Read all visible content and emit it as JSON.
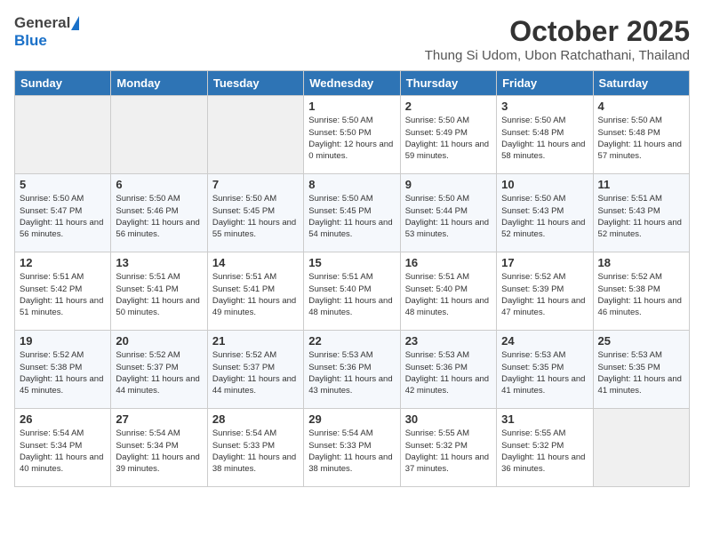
{
  "header": {
    "logo_general": "General",
    "logo_blue": "Blue",
    "month_year": "October 2025",
    "location": "Thung Si Udom, Ubon Ratchathani, Thailand"
  },
  "days_of_week": [
    "Sunday",
    "Monday",
    "Tuesday",
    "Wednesday",
    "Thursday",
    "Friday",
    "Saturday"
  ],
  "weeks": [
    [
      {
        "day": "",
        "info": ""
      },
      {
        "day": "",
        "info": ""
      },
      {
        "day": "",
        "info": ""
      },
      {
        "day": "1",
        "info": "Sunrise: 5:50 AM\nSunset: 5:50 PM\nDaylight: 12 hours\nand 0 minutes."
      },
      {
        "day": "2",
        "info": "Sunrise: 5:50 AM\nSunset: 5:49 PM\nDaylight: 11 hours\nand 59 minutes."
      },
      {
        "day": "3",
        "info": "Sunrise: 5:50 AM\nSunset: 5:48 PM\nDaylight: 11 hours\nand 58 minutes."
      },
      {
        "day": "4",
        "info": "Sunrise: 5:50 AM\nSunset: 5:48 PM\nDaylight: 11 hours\nand 57 minutes."
      }
    ],
    [
      {
        "day": "5",
        "info": "Sunrise: 5:50 AM\nSunset: 5:47 PM\nDaylight: 11 hours\nand 56 minutes."
      },
      {
        "day": "6",
        "info": "Sunrise: 5:50 AM\nSunset: 5:46 PM\nDaylight: 11 hours\nand 56 minutes."
      },
      {
        "day": "7",
        "info": "Sunrise: 5:50 AM\nSunset: 5:45 PM\nDaylight: 11 hours\nand 55 minutes."
      },
      {
        "day": "8",
        "info": "Sunrise: 5:50 AM\nSunset: 5:45 PM\nDaylight: 11 hours\nand 54 minutes."
      },
      {
        "day": "9",
        "info": "Sunrise: 5:50 AM\nSunset: 5:44 PM\nDaylight: 11 hours\nand 53 minutes."
      },
      {
        "day": "10",
        "info": "Sunrise: 5:50 AM\nSunset: 5:43 PM\nDaylight: 11 hours\nand 52 minutes."
      },
      {
        "day": "11",
        "info": "Sunrise: 5:51 AM\nSunset: 5:43 PM\nDaylight: 11 hours\nand 52 minutes."
      }
    ],
    [
      {
        "day": "12",
        "info": "Sunrise: 5:51 AM\nSunset: 5:42 PM\nDaylight: 11 hours\nand 51 minutes."
      },
      {
        "day": "13",
        "info": "Sunrise: 5:51 AM\nSunset: 5:41 PM\nDaylight: 11 hours\nand 50 minutes."
      },
      {
        "day": "14",
        "info": "Sunrise: 5:51 AM\nSunset: 5:41 PM\nDaylight: 11 hours\nand 49 minutes."
      },
      {
        "day": "15",
        "info": "Sunrise: 5:51 AM\nSunset: 5:40 PM\nDaylight: 11 hours\nand 48 minutes."
      },
      {
        "day": "16",
        "info": "Sunrise: 5:51 AM\nSunset: 5:40 PM\nDaylight: 11 hours\nand 48 minutes."
      },
      {
        "day": "17",
        "info": "Sunrise: 5:52 AM\nSunset: 5:39 PM\nDaylight: 11 hours\nand 47 minutes."
      },
      {
        "day": "18",
        "info": "Sunrise: 5:52 AM\nSunset: 5:38 PM\nDaylight: 11 hours\nand 46 minutes."
      }
    ],
    [
      {
        "day": "19",
        "info": "Sunrise: 5:52 AM\nSunset: 5:38 PM\nDaylight: 11 hours\nand 45 minutes."
      },
      {
        "day": "20",
        "info": "Sunrise: 5:52 AM\nSunset: 5:37 PM\nDaylight: 11 hours\nand 44 minutes."
      },
      {
        "day": "21",
        "info": "Sunrise: 5:52 AM\nSunset: 5:37 PM\nDaylight: 11 hours\nand 44 minutes."
      },
      {
        "day": "22",
        "info": "Sunrise: 5:53 AM\nSunset: 5:36 PM\nDaylight: 11 hours\nand 43 minutes."
      },
      {
        "day": "23",
        "info": "Sunrise: 5:53 AM\nSunset: 5:36 PM\nDaylight: 11 hours\nand 42 minutes."
      },
      {
        "day": "24",
        "info": "Sunrise: 5:53 AM\nSunset: 5:35 PM\nDaylight: 11 hours\nand 41 minutes."
      },
      {
        "day": "25",
        "info": "Sunrise: 5:53 AM\nSunset: 5:35 PM\nDaylight: 11 hours\nand 41 minutes."
      }
    ],
    [
      {
        "day": "26",
        "info": "Sunrise: 5:54 AM\nSunset: 5:34 PM\nDaylight: 11 hours\nand 40 minutes."
      },
      {
        "day": "27",
        "info": "Sunrise: 5:54 AM\nSunset: 5:34 PM\nDaylight: 11 hours\nand 39 minutes."
      },
      {
        "day": "28",
        "info": "Sunrise: 5:54 AM\nSunset: 5:33 PM\nDaylight: 11 hours\nand 38 minutes."
      },
      {
        "day": "29",
        "info": "Sunrise: 5:54 AM\nSunset: 5:33 PM\nDaylight: 11 hours\nand 38 minutes."
      },
      {
        "day": "30",
        "info": "Sunrise: 5:55 AM\nSunset: 5:32 PM\nDaylight: 11 hours\nand 37 minutes."
      },
      {
        "day": "31",
        "info": "Sunrise: 5:55 AM\nSunset: 5:32 PM\nDaylight: 11 hours\nand 36 minutes."
      },
      {
        "day": "",
        "info": ""
      }
    ]
  ]
}
